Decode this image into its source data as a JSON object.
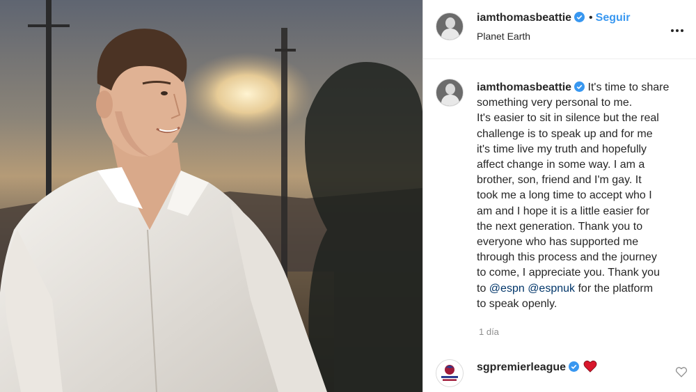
{
  "post": {
    "username": "iamthomasbeattie",
    "follow_label": "Seguir",
    "location": "Planet Earth",
    "caption_lines": [
      "It's time to share",
      "something very personal to me.",
      "It's easier to sit in silence but the real",
      "challenge is to speak up and for me",
      "it's time live my truth and hopefully",
      "affect change in some way. I am a",
      "brother, son, friend and I'm gay. It",
      "took me a long time to accept who I",
      "am and I hope it is a little easier for",
      "the next generation. Thank you to",
      "everyone who has supported me",
      "through this process and the journey",
      "to come, I appreciate you. Thank you",
      "to"
    ],
    "mention_1": "@espn",
    "mention_2": "@espnuk",
    "caption_tail_1": "for the platform",
    "caption_tail_2": "to speak openly.",
    "time_ago": "1 día"
  },
  "comment": {
    "username": "sgpremierleague",
    "emoji": "heart-red-icon"
  },
  "colors": {
    "link_blue": "#3897f0",
    "mention": "#003569",
    "verified": "#3897f0",
    "heart": "#ed4956",
    "muted": "#8e8e8e"
  },
  "icons": [
    "verified-badge-icon",
    "more-options-icon",
    "heart-red-icon",
    "like-heart-outline-icon"
  ]
}
